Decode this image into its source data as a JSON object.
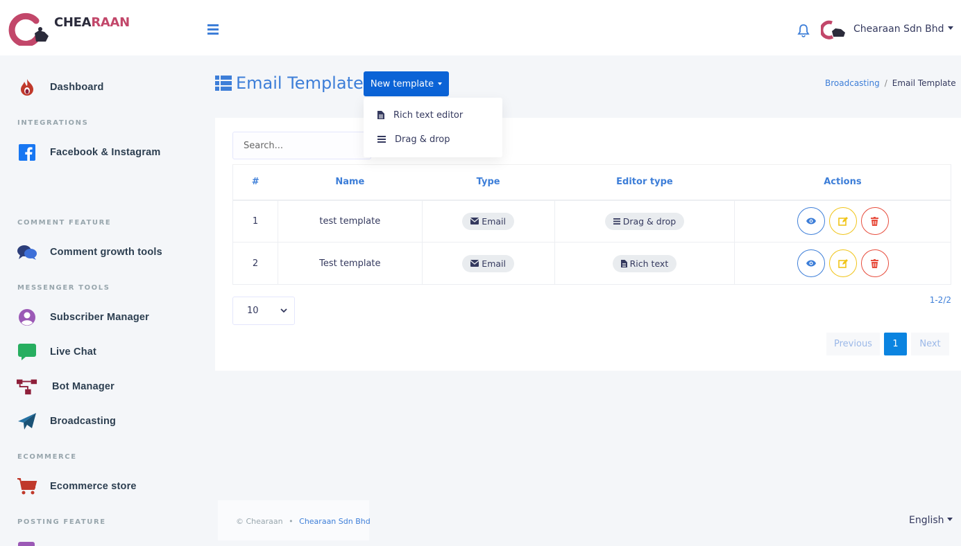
{
  "brand": {
    "logo_text_a": "CHEA",
    "logo_text_b": "RAAN",
    "logo_sub": "CHEARAAN"
  },
  "header": {
    "company": "Chearaan Sdn Bhd"
  },
  "sidebar": {
    "items": [
      {
        "label": "Dashboard"
      },
      {
        "label": "Facebook & Instagram"
      },
      {
        "label": "Comment growth tools"
      },
      {
        "label": "Subscriber Manager"
      },
      {
        "label": "Live Chat"
      },
      {
        "label": "Bot Manager"
      },
      {
        "label": "Broadcasting"
      },
      {
        "label": "Ecommerce store"
      }
    ],
    "sections": {
      "integrations": "INTEGRATIONS",
      "comment": "COMMENT FEATURE",
      "messenger": "MESSENGER TOOLS",
      "ecommerce": "ECOMMERCE",
      "posting": "POSTING FEATURE"
    }
  },
  "page": {
    "title": "Email Template",
    "new_button": "New template",
    "dropdown": {
      "rich": "Rich text editor",
      "drag": "Drag & drop"
    },
    "breadcrumb": {
      "parent": "Broadcasting",
      "separator": "/",
      "current": "Email Template"
    }
  },
  "search": {
    "placeholder": "Search..."
  },
  "table": {
    "headers": {
      "num": "#",
      "name": "Name",
      "type": "Type",
      "editor": "Editor type",
      "actions": "Actions"
    },
    "rows": [
      {
        "num": "1",
        "name": "test template",
        "type": "Email",
        "editor": "Drag & drop"
      },
      {
        "num": "2",
        "name": "Test template",
        "type": "Email",
        "editor": "Rich text"
      }
    ]
  },
  "pagination": {
    "per_page": "10",
    "range": "1-2/2",
    "prev": "Previous",
    "current": "1",
    "next": "Next"
  },
  "footer": {
    "copyright": "© Chearaan",
    "dot": "•",
    "company": "Chearaan Sdn Bhd"
  },
  "language": "English",
  "colors": {
    "accent": "#3d7ed8",
    "primary_button": "#0b63d6",
    "edit": "#f0c419",
    "delete": "#e74c3c"
  }
}
